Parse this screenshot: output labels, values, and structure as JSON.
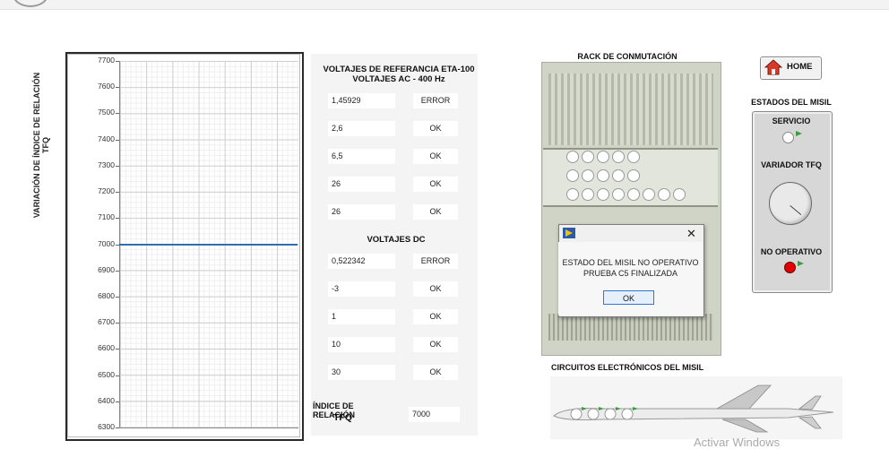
{
  "chart": {
    "ylabel_line1": "VARIACIÓN DE ÍNDICE DE RELACIÓN",
    "ylabel_line2": "TFQ",
    "ticks": [
      "7700",
      "7600",
      "7500",
      "7400",
      "7300",
      "7200",
      "7100",
      "7000",
      "6900",
      "6800",
      "6700",
      "6600",
      "6500",
      "6400",
      "6300"
    ]
  },
  "chart_data": {
    "type": "line",
    "title": "",
    "xlabel": "",
    "ylabel": "VARIACIÓN DE ÍNDICE DE RELACIÓN TFQ",
    "ylim": [
      6300,
      7700
    ],
    "grid": true,
    "series": [
      {
        "values": [
          7000,
          7000
        ]
      }
    ]
  },
  "ac_section": {
    "title_line1": "VOLTAJES DE REFERANCIA   ETA-100",
    "title_line2": "VOLTAJES AC - 400 Hz",
    "rows": [
      {
        "value": "1,45929",
        "status": "ERROR"
      },
      {
        "value": "2,6",
        "status": "OK"
      },
      {
        "value": "6,5",
        "status": "OK"
      },
      {
        "value": "26",
        "status": "OK"
      },
      {
        "value": "26",
        "status": "OK"
      }
    ]
  },
  "dc_section": {
    "title": "VOLTAJES DC",
    "rows": [
      {
        "value": "0,522342",
        "status": "ERROR"
      },
      {
        "value": "-3",
        "status": "OK"
      },
      {
        "value": "1",
        "status": "OK"
      },
      {
        "value": "10",
        "status": "OK"
      },
      {
        "value": "30",
        "status": "OK"
      }
    ]
  },
  "index": {
    "label_line1": "ÍNDICE DE RELACIÓN",
    "label_line2": "TFQ",
    "value": "7000"
  },
  "rack": {
    "title": "RACK DE CONMUTACIÓN"
  },
  "dialog": {
    "message_line1": "ESTADO DEL MISIL NO OPERATIVO",
    "message_line2": "PRUEBA C5 FINALIZADA",
    "ok_label": "OK",
    "close_glyph": "✕"
  },
  "home": {
    "label": "HOME"
  },
  "states": {
    "title": "ESTADOS DEL MISIL",
    "servicio_label": "SERVICIO",
    "variador_label": "VARIADOR TFQ",
    "no_operativo_label": "NO OPERATIVO"
  },
  "circuits": {
    "title": "CIRCUITOS ELECTRÓNICOS DEL MISIL"
  },
  "watermark": "Activar Windows",
  "colors": {
    "series": "#2f6fae",
    "alarm_led": "#e20000",
    "flag": "#3f9a3f",
    "dialog_accent": "#2f78d3"
  }
}
